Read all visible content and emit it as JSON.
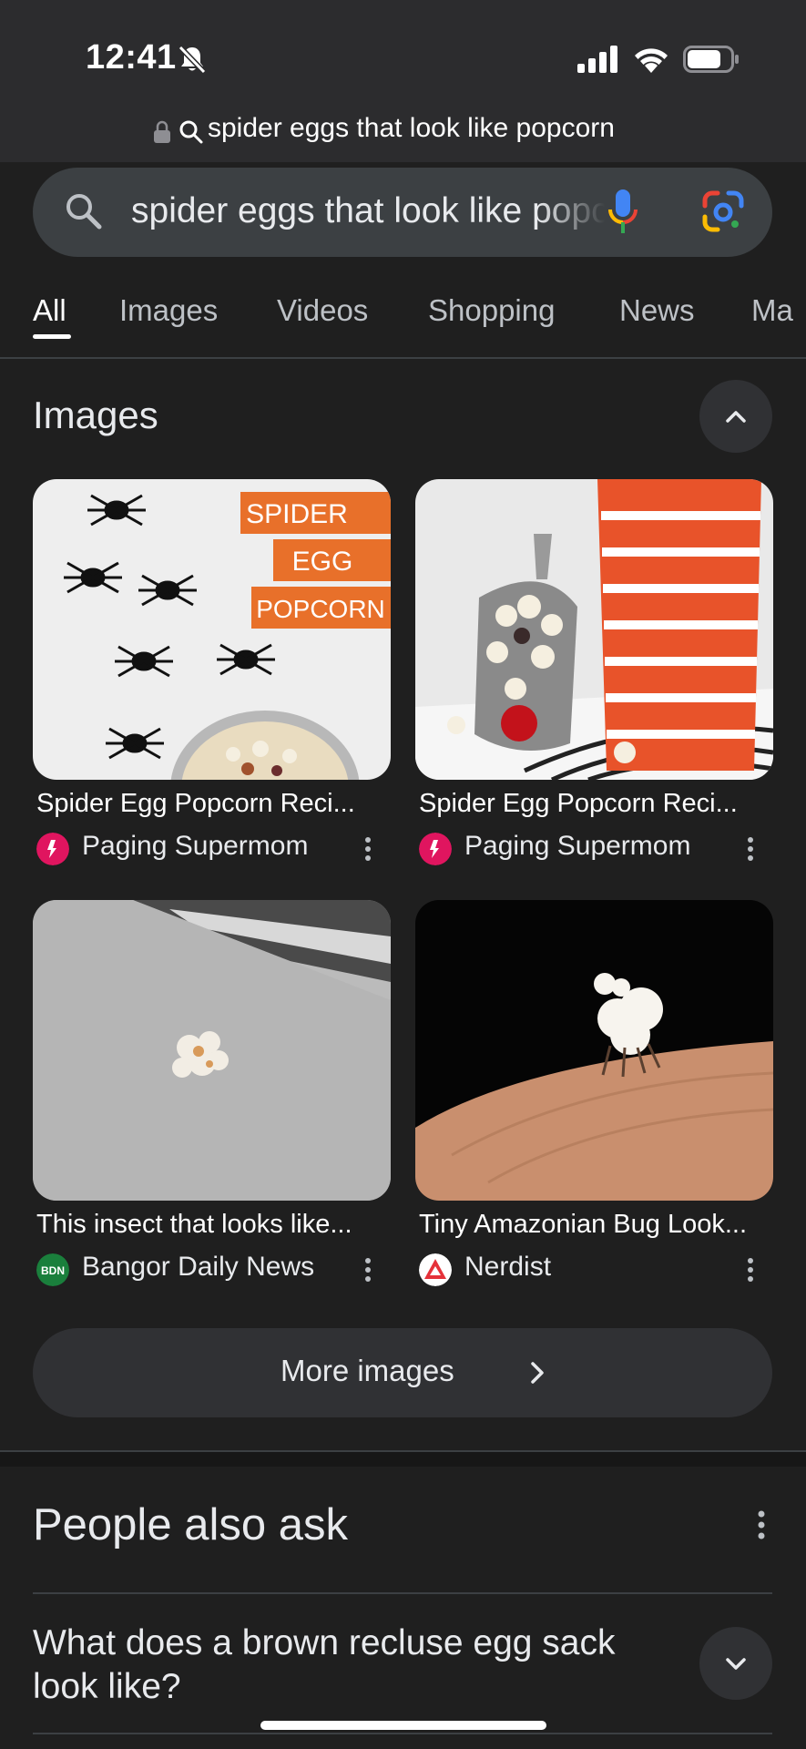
{
  "status_bar": {
    "time": "12:41"
  },
  "url_bar": {
    "text": "spider eggs that look like popcorn"
  },
  "search": {
    "query": "spider eggs that look like popcorn"
  },
  "tabs": [
    {
      "label": "All",
      "active": true
    },
    {
      "label": "Images"
    },
    {
      "label": "Videos"
    },
    {
      "label": "Shopping"
    },
    {
      "label": "News"
    },
    {
      "label": "Ma"
    }
  ],
  "images_section": {
    "title": "Images",
    "results": [
      {
        "caption": "Spider Egg Popcorn Reci...",
        "source": "Paging Supermom",
        "image_text": [
          "SPIDER",
          "EGG",
          "POPCORN"
        ]
      },
      {
        "caption": "Spider Egg Popcorn Reci...",
        "source": "Paging Supermom"
      },
      {
        "caption": "This insect that looks like...",
        "source": "Bangor Daily News",
        "source_logo_text": "BDN"
      },
      {
        "caption": "Tiny Amazonian Bug Look...",
        "source": "Nerdist"
      }
    ],
    "more_label": "More images"
  },
  "people_also_ask": {
    "title": "People also ask",
    "questions": [
      "What does a brown recluse egg sack look like?"
    ]
  },
  "colors": {
    "background": "#1f1f1f",
    "surface": "#303134",
    "search_box": "#3c4043",
    "paging_supermom": "#e0155f",
    "bangor_daily_news": "#1a7f3c",
    "nerdist": "#e5323a"
  }
}
